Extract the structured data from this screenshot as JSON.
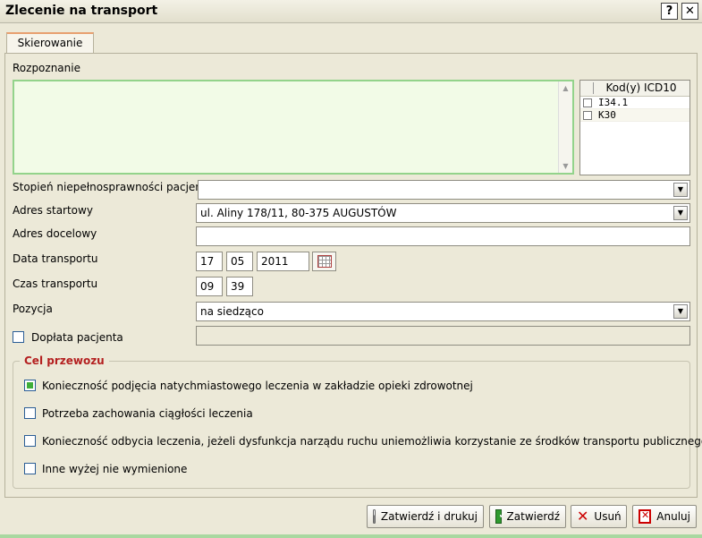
{
  "window": {
    "title": "Zlecenie na transport",
    "help": "?",
    "close": "✕"
  },
  "tab": {
    "label": "Skierowanie"
  },
  "diagnosis": {
    "label": "Rozpoznanie",
    "value": ""
  },
  "icd": {
    "header": "Kod(y) ICD10",
    "rows": [
      {
        "code": "I34.1",
        "checked": false
      },
      {
        "code": "K30",
        "checked": false
      }
    ]
  },
  "disability": {
    "label": "Stopień niepełnosprawności pacjenta",
    "value": ""
  },
  "start_address": {
    "label": "Adres startowy",
    "value": "ul. Aliny 178/11, 80-375 AUGUSTÓW"
  },
  "dest_address": {
    "label": "Adres docelowy",
    "value": ""
  },
  "transport_date": {
    "label": "Data transportu",
    "day": "17",
    "month": "05",
    "year": "2011"
  },
  "transport_time": {
    "label": "Czas transportu",
    "hour": "09",
    "minute": "39"
  },
  "position": {
    "label": "Pozycja",
    "value": "na siedząco"
  },
  "copay": {
    "label": "Dopłata pacjenta",
    "checked": false,
    "value": ""
  },
  "purpose": {
    "legend": "Cel przewozu",
    "options": [
      {
        "label": "Konieczność podjęcia natychmiastowego leczenia w zakładzie opieki zdrowotnej",
        "checked": true
      },
      {
        "label": "Potrzeba zachowania ciągłości leczenia",
        "checked": false
      },
      {
        "label": "Konieczność odbycia leczenia, jeżeli dysfunkcja narządu ruchu uniemożliwia korzystanie ze środków transportu publicznego",
        "checked": false
      },
      {
        "label": "Inne wyżej nie wymienione",
        "checked": false
      }
    ]
  },
  "buttons": {
    "confirm_print": "Zatwierdź i drukuj",
    "confirm": "Zatwierdź",
    "delete": "Usuń",
    "cancel": "Anuluj"
  },
  "icons": {
    "help": "help-icon",
    "close": "close-icon",
    "dropdown": "chevron-down-icon",
    "calendar": "calendar-icon",
    "print": "printer-icon",
    "confirm": "check-icon",
    "delete": "x-icon",
    "cancel": "cancel-icon"
  }
}
